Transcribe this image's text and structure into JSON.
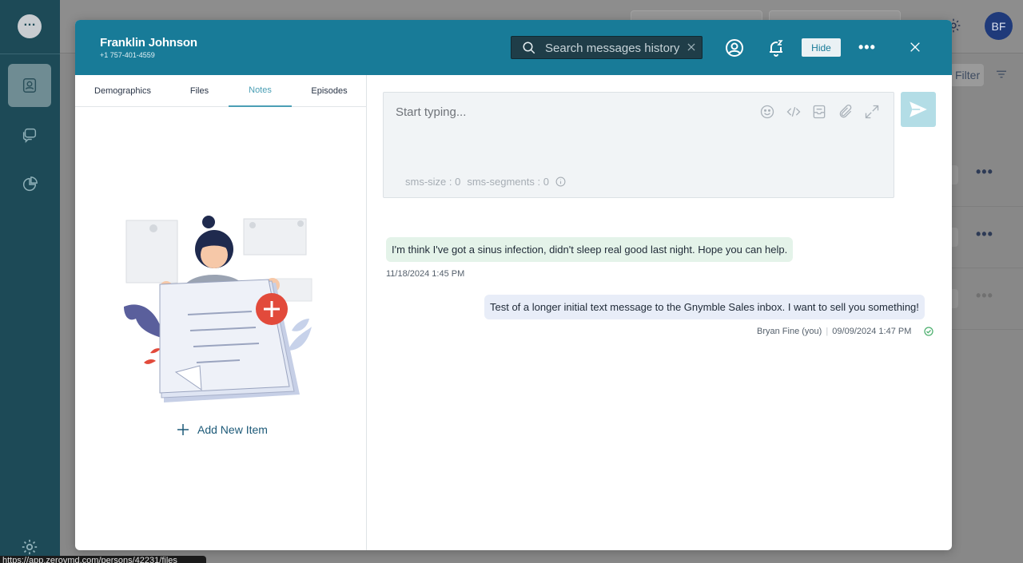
{
  "app": {
    "avatar_initials": "BF",
    "filter_label": "Filter",
    "status_url": "https://app.zerovmd.com/persons/42231/files"
  },
  "contact": {
    "name": "Franklin Johnson",
    "phone": "+1 757-401-4559"
  },
  "header": {
    "search_placeholder": "Search messages history",
    "hide_label": "Hide",
    "more_label": "•••"
  },
  "tabs": [
    {
      "label": "Demographics",
      "active": false
    },
    {
      "label": "Files",
      "active": false
    },
    {
      "label": "Notes",
      "active": true
    },
    {
      "label": "Episodes",
      "active": false
    }
  ],
  "notes": {
    "add_label": "Add New Item"
  },
  "composer": {
    "placeholder": "Start typing...",
    "sms_size": "sms-size : 0",
    "sms_segments": "sms-segments : 0"
  },
  "messages": [
    {
      "direction": "incoming",
      "text": "I'm think I've got a sinus infection, didn't sleep real good last night. Hope you can help.",
      "timestamp": "11/18/2024 1:45 PM"
    },
    {
      "direction": "outgoing",
      "text": "Test of a longer initial text message to the Gnymble Sales inbox. I want to sell you something!",
      "sender": "Bryan Fine (you)",
      "timestamp": "09/09/2024 1:47 PM"
    }
  ],
  "colors": {
    "header": "#187b98",
    "accent": "#4b9fb5",
    "sidebar": "#1d4a57"
  }
}
